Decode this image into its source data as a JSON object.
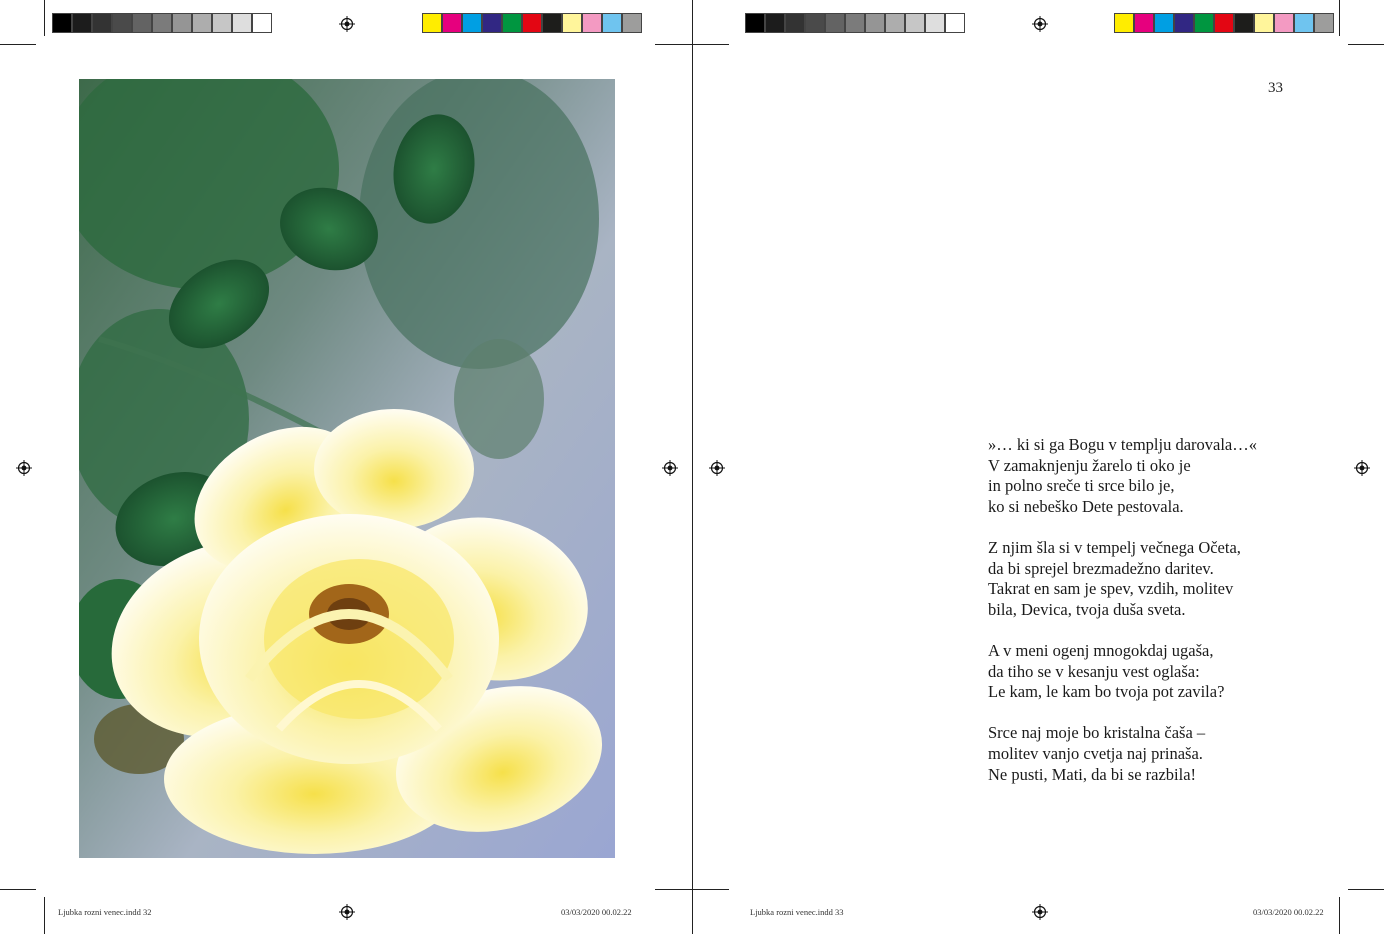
{
  "print_marks": {
    "grayscale_swatches": [
      "#000000",
      "#1c1c1c",
      "#333333",
      "#4a4a4a",
      "#636363",
      "#7b7b7b",
      "#959595",
      "#adadad",
      "#c6c6c6",
      "#dedede",
      "#ffffff"
    ],
    "color_swatches": [
      "#ffed00",
      "#e6007e",
      "#009fe3",
      "#312783",
      "#009640",
      "#e30613",
      "#1d1d1b",
      "#fff59b",
      "#f39ac2",
      "#6fc4ef",
      "#9d9d9c"
    ]
  },
  "left_page": {
    "photo": {
      "subject": "pale yellow rose with green leaves",
      "icon": "rose-photo"
    },
    "footer": {
      "file": "Ljubka rozni venec.indd   32",
      "timestamp": "03/03/2020   00.02.22"
    }
  },
  "right_page": {
    "page_number": "33",
    "poem": {
      "stanzas": [
        [
          "»… ki si ga Bogu v templju darovala…«",
          "V zamaknjenju žarelo ti oko je",
          "in polno sreče ti srce bilo je,",
          "ko si nebeško Dete pestovala."
        ],
        [
          "Z njim šla si v tempelj večnega Očeta,",
          "da bi sprejel brezmadežno daritev.",
          "Takrat en sam je spev, vzdih, molitev",
          "bila, Devica, tvoja duša sveta."
        ],
        [
          "A v meni ogenj mnogokdaj ugaša,",
          "da tiho se v kesanju vest oglaša:",
          "Le kam, le kam bo tvoja pot zavila?"
        ],
        [
          "Srce naj moje bo kristalna čaša –",
          "molitev vanjo cvetja naj prinaša.",
          "Ne pusti, Mati, da bi se razbila!"
        ]
      ]
    },
    "footer": {
      "file": "Ljubka rozni venec.indd   33",
      "timestamp": "03/03/2020   00.02.22"
    }
  }
}
